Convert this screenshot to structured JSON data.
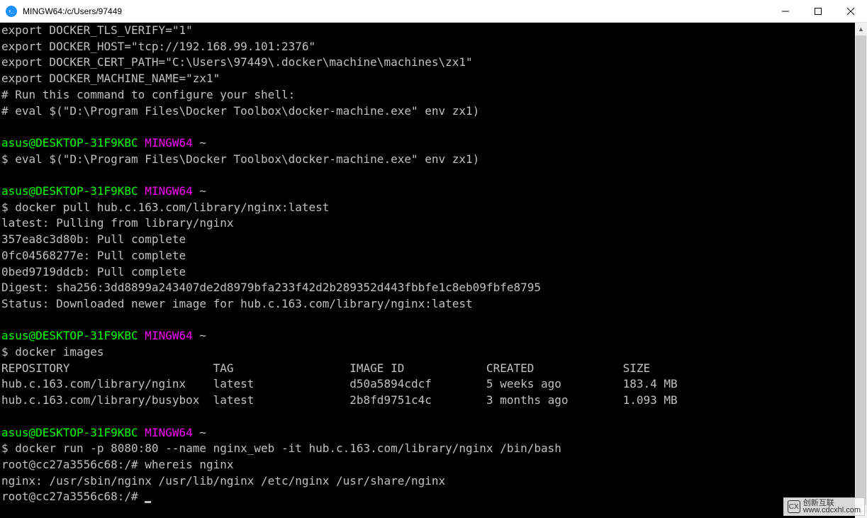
{
  "window": {
    "title": "MINGW64:/c/Users/97449"
  },
  "terminal": {
    "l1": "export DOCKER_TLS_VERIFY=\"1\"",
    "l2": "export DOCKER_HOST=\"tcp://192.168.99.101:2376\"",
    "l3": "export DOCKER_CERT_PATH=\"C:\\Users\\97449\\.docker\\machine\\machines\\zx1\"",
    "l4": "export DOCKER_MACHINE_NAME=\"zx1\"",
    "l5": "# Run this command to configure your shell:",
    "l6": "# eval $(\"D:\\Program Files\\Docker Toolbox\\docker-machine.exe\" env zx1)",
    "prompt_user": "asus@DESKTOP-31F9KBC",
    "prompt_env": "MINGW64",
    "prompt_path": "~",
    "cmd1": "$ eval $(\"D:\\Program Files\\Docker Toolbox\\docker-machine.exe\" env zx1)",
    "cmd2": "$ docker pull hub.c.163.com/library/nginx:latest",
    "pull1": "latest: Pulling from library/nginx",
    "pull2": "357ea8c3d80b: Pull complete",
    "pull3": "0fc04568277e: Pull complete",
    "pull4": "0bed9719ddcb: Pull complete",
    "pull5": "Digest: sha256:3dd8899a243407de2d8979bfa233f42d2b289352d443fbbfe1c8eb09fbfe8795",
    "pull6": "Status: Downloaded newer image for hub.c.163.com/library/nginx:latest",
    "cmd3": "$ docker images",
    "images_header": "REPOSITORY                     TAG                 IMAGE ID            CREATED             SIZE",
    "images_row1": "hub.c.163.com/library/nginx    latest              d50a5894cdcf        5 weeks ago         183.4 MB",
    "images_row2": "hub.c.163.com/library/busybox  latest              2b8fd9751c4c        3 months ago        1.093 MB",
    "cmd4": "$ docker run -p 8080:80 --name nginx_web -it hub.c.163.com/library/nginx /bin/bash",
    "root1": "root@cc27a3556c68:/# whereis nginx",
    "root2": "nginx: /usr/sbin/nginx /usr/lib/nginx /etc/nginx /usr/share/nginx",
    "root3": "root@cc27a3556c68:/# "
  },
  "watermark": {
    "logo": "CX",
    "line1": "创新互联",
    "line2": "www.cdcxhl.com"
  }
}
